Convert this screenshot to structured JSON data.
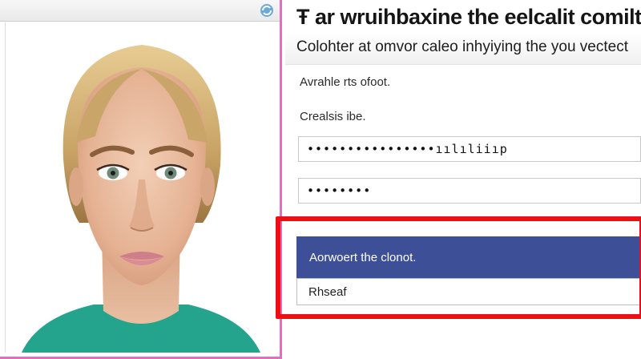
{
  "photo": {
    "topbar_icon": "refresh-icon"
  },
  "form": {
    "headline": "Ŧ ar wruihbaxine the eelcalit comilte:your Hraliis in",
    "subheadline": "Colohter at omvor caleo inhyiying the you vectect",
    "label_username": "Avrahle rts ofoot.",
    "label_password": "Crealsis ibe.",
    "username_value": "••••••••••••••••ıılıliiıp",
    "password_value": "••••••••",
    "submit_label": "Aorwoert the clonot.",
    "secondary_label": "Rhseaf"
  },
  "colors": {
    "accent_pink": "#e46dc0",
    "highlight_red": "#ee0e16",
    "button_blue": "#3d4f97"
  }
}
